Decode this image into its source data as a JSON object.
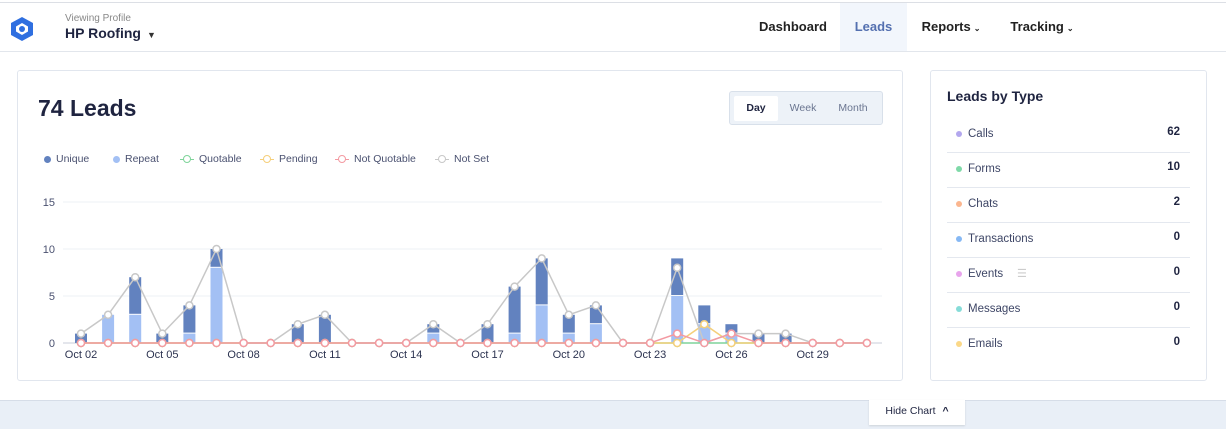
{
  "header": {
    "viewing_label": "Viewing Profile",
    "profile_name": "HP Roofing",
    "nav": [
      {
        "label": "Dashboard"
      },
      {
        "label": "Leads"
      },
      {
        "label": "Reports"
      },
      {
        "label": "Tracking"
      }
    ]
  },
  "chart_card": {
    "title": "74 Leads",
    "toggle": [
      "Day",
      "Week",
      "Month"
    ],
    "selected": "Day"
  },
  "colors": {
    "unique": "#6282bf",
    "repeat": "#a3c0f4",
    "quotable": "#7fd49a",
    "pending": "#f5cf7a",
    "not_quotable": "#f39aa2",
    "not_set": "#c8c8c8"
  },
  "chart_data": {
    "type": "bar",
    "legend": [
      "Unique",
      "Repeat",
      "Quotable",
      "Pending",
      "Not Quotable",
      "Not Set"
    ],
    "x": [
      "Oct 02",
      "Oct 03",
      "Oct 04",
      "Oct 05",
      "Oct 06",
      "Oct 07",
      "Oct 08",
      "Oct 09",
      "Oct 10",
      "Oct 11",
      "Oct 12",
      "Oct 13",
      "Oct 14",
      "Oct 15",
      "Oct 16",
      "Oct 17",
      "Oct 18",
      "Oct 19",
      "Oct 20",
      "Oct 21",
      "Oct 22",
      "Oct 23",
      "Oct 24",
      "Oct 25",
      "Oct 26",
      "Oct 27",
      "Oct 28",
      "Oct 29",
      "Oct 30",
      "Oct 31"
    ],
    "xtick_labels": [
      "Oct 02",
      "Oct 05",
      "Oct 08",
      "Oct 11",
      "Oct 14",
      "Oct 17",
      "Oct 20",
      "Oct 23",
      "Oct 26",
      "Oct 29"
    ],
    "yticks": [
      0,
      5,
      10,
      15
    ],
    "ylim": [
      0,
      15
    ],
    "series": [
      {
        "name": "Unique",
        "kind": "bar",
        "values": [
          1,
          0,
          4,
          1,
          3,
          2,
          0,
          0,
          2,
          3,
          0,
          0,
          0,
          1,
          0,
          2,
          5,
          5,
          2,
          2,
          0,
          0,
          4,
          2,
          1,
          1,
          1,
          0,
          0,
          0
        ]
      },
      {
        "name": "Repeat",
        "kind": "bar",
        "values": [
          0,
          3,
          3,
          0,
          1,
          8,
          0,
          0,
          0,
          0,
          0,
          0,
          0,
          1,
          0,
          0,
          1,
          4,
          1,
          2,
          0,
          0,
          5,
          2,
          1,
          0,
          0,
          0,
          0,
          0
        ]
      },
      {
        "name": "Quotable",
        "kind": "line",
        "values": [
          0,
          0,
          0,
          0,
          0,
          0,
          0,
          0,
          0,
          0,
          0,
          0,
          0,
          0,
          0,
          0,
          0,
          0,
          0,
          0,
          0,
          0,
          0,
          0,
          0,
          0,
          0,
          0,
          0,
          0
        ]
      },
      {
        "name": "Pending",
        "kind": "line",
        "values": [
          0,
          0,
          0,
          0,
          0,
          0,
          0,
          0,
          0,
          0,
          0,
          0,
          0,
          0,
          0,
          0,
          0,
          0,
          0,
          0,
          0,
          0,
          0,
          2,
          0,
          0,
          0,
          0,
          0,
          0
        ]
      },
      {
        "name": "Not Quotable",
        "kind": "line",
        "values": [
          0,
          0,
          0,
          0,
          0,
          0,
          0,
          0,
          0,
          0,
          0,
          0,
          0,
          0,
          0,
          0,
          0,
          0,
          0,
          0,
          0,
          0,
          1,
          0,
          1,
          0,
          0,
          0,
          0,
          0
        ]
      },
      {
        "name": "Not Set",
        "kind": "line",
        "values": [
          1,
          3,
          7,
          1,
          4,
          10,
          0,
          0,
          2,
          3,
          0,
          0,
          0,
          2,
          0,
          2,
          6,
          9,
          3,
          4,
          0,
          0,
          8,
          0,
          1,
          1,
          1,
          0,
          0,
          0
        ]
      }
    ]
  },
  "leads_by_type": {
    "title": "Leads by Type",
    "items": [
      {
        "label": "Calls",
        "value": "62",
        "color": "#b3a7ee"
      },
      {
        "label": "Forms",
        "value": "10",
        "color": "#7fd9a8"
      },
      {
        "label": "Chats",
        "value": "2",
        "color": "#fbb68f"
      },
      {
        "label": "Transactions",
        "value": "0",
        "color": "#86b8f4"
      },
      {
        "label": "Events",
        "value": "0",
        "color": "#e8a4ec"
      },
      {
        "label": "Messages",
        "value": "0",
        "color": "#86dcd8"
      },
      {
        "label": "Emails",
        "value": "0",
        "color": "#fbd888"
      }
    ]
  },
  "footer": {
    "hide_chart": "Hide Chart"
  }
}
